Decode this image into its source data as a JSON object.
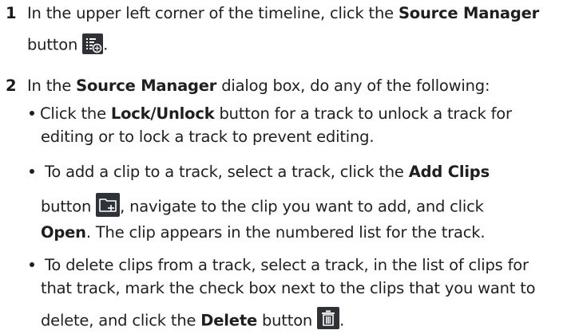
{
  "steps": [
    {
      "number": "1",
      "line1_pre": "In the upper left corner of the timeline, click the ",
      "line1_bold": "Source Manager",
      "line2_pre": "button",
      "line2_post": ".",
      "icon": "source-manager-icon"
    },
    {
      "number": "2",
      "line1_pre": "In the ",
      "line1_bold": "Source Manager",
      "line1_post": " dialog box, do any of the following:"
    }
  ],
  "bullets": [
    {
      "l1_pre": "Click the ",
      "l1_bold": "Lock/Unlock",
      "l1_post": " button for a track to unlock a track for",
      "l2": "editing or to lock a track to prevent editing."
    },
    {
      "l1_pre": " To add a clip to a track, select a track, click the ",
      "l1_bold": "Add Clips",
      "l2_pre": "button",
      "l2_post": ", navigate to the clip you want to add, and click",
      "l3_bold": "Open",
      "l3_post": ". The clip appears in the numbered list for the track.",
      "icon": "add-clips-icon"
    },
    {
      "l1": " To delete clips from a track, select a track, in the list of clips for",
      "l2": "that track, mark the check box next to the clips that you want to",
      "l3_pre": "delete, and click the ",
      "l3_bold": "Delete",
      "l3_post": " button",
      "icon": "delete-icon"
    }
  ],
  "colors": {
    "text": "#1f1f1f",
    "icon_bg": "#2f3237",
    "icon_fg": "#ffffff"
  }
}
